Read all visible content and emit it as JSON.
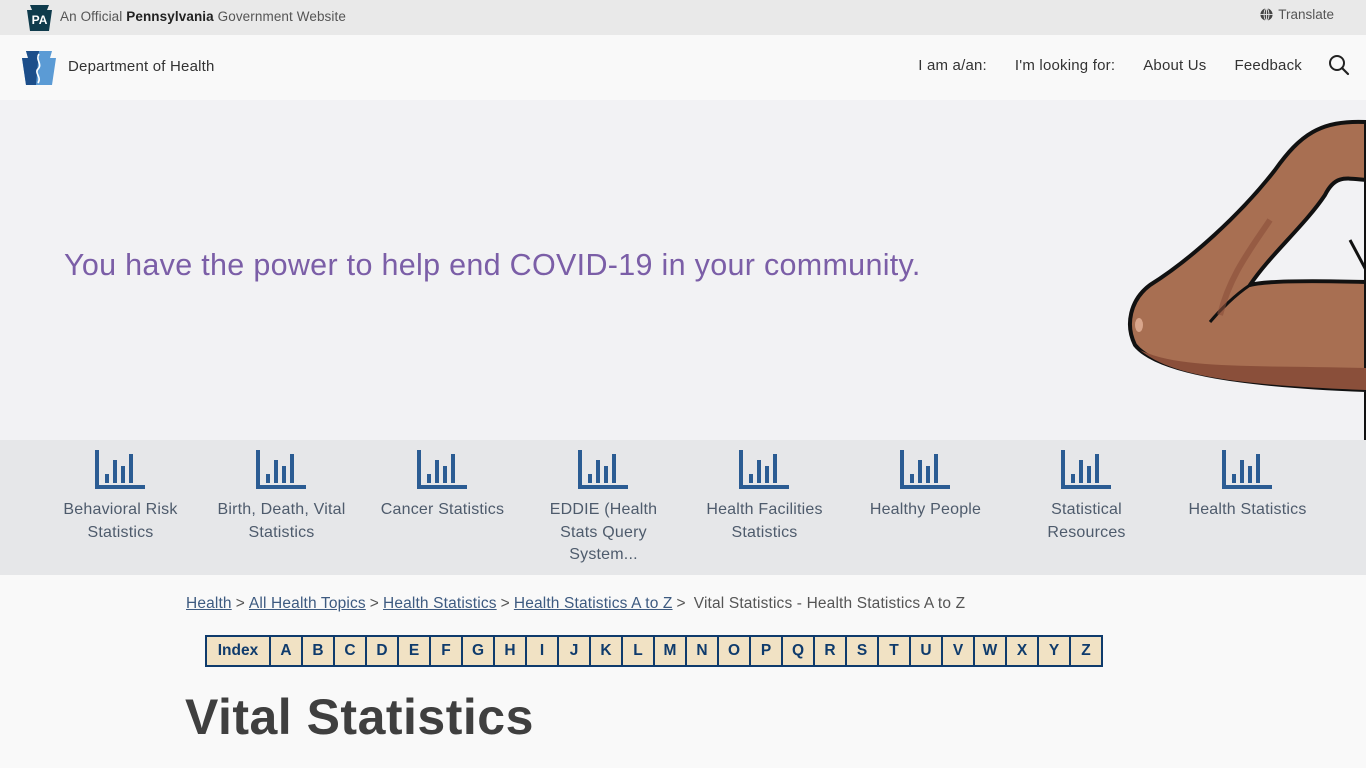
{
  "official_bar": {
    "logo_text": "PA",
    "text_prefix": "An Official",
    "text_bold": "Pennsylvania",
    "text_suffix": "Government Website",
    "translate_label": "Translate"
  },
  "header": {
    "department": "Department of Health",
    "nav": [
      "I am a/an:",
      "I'm looking for:",
      "About Us",
      "Feedback"
    ]
  },
  "hero": {
    "headline": "You have the power to help end COVID-19 in your community."
  },
  "quick_links": [
    {
      "label": "Behavioral Risk Statistics",
      "icon": "bar-chart-icon"
    },
    {
      "label": "Birth, Death, Vital Statistics",
      "icon": "bar-chart-icon"
    },
    {
      "label": "Cancer Statistics",
      "icon": "bar-chart-icon"
    },
    {
      "label": "EDDIE (Health Stats Query System...",
      "icon": "bar-chart-icon"
    },
    {
      "label": "Health Facilities Statistics",
      "icon": "bar-chart-icon"
    },
    {
      "label": "Healthy People",
      "icon": "bar-chart-icon"
    },
    {
      "label": "Statistical Resources",
      "icon": "bar-chart-icon"
    },
    {
      "label": "Health Statistics",
      "icon": "bar-chart-icon"
    }
  ],
  "breadcrumb": {
    "links": [
      "Health",
      "All Health Topics",
      "Health Statistics",
      "Health Statistics A to Z"
    ],
    "separator": ">",
    "current": "Vital Statistics - Health Statistics A to Z"
  },
  "az_index": [
    "Index",
    "A",
    "B",
    "C",
    "D",
    "E",
    "F",
    "G",
    "H",
    "I",
    "J",
    "K",
    "L",
    "M",
    "N",
    "O",
    "P",
    "Q",
    "R",
    "S",
    "T",
    "U",
    "V",
    "W",
    "X",
    "Y",
    "Z"
  ],
  "page_title": "Vital Statistics",
  "colors": {
    "brand_blue": "#0f3b6c",
    "icon_blue": "#2b5c93",
    "hero_purple": "#7b5ea7",
    "az_background": "#f1e2c4"
  }
}
